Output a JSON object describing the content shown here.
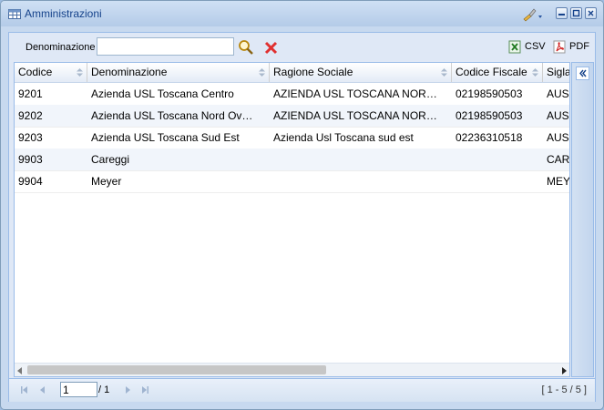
{
  "window": {
    "title": "Amministrazioni"
  },
  "toolbar": {
    "filter_label": "Denominazione",
    "filter_value": "",
    "csv_label": "CSV",
    "pdf_label": "PDF"
  },
  "grid": {
    "columns": [
      "Codice",
      "Denominazione",
      "Ragione Sociale",
      "Codice Fiscale",
      "Sigla"
    ],
    "rows": [
      [
        "9201",
        "Azienda USL Toscana Centro",
        "AZIENDA USL TOSCANA NOR…",
        "02198590503",
        "AUSL"
      ],
      [
        "9202",
        "Azienda USL Toscana Nord Ov…",
        "AZIENDA USL TOSCANA NOR…",
        "02198590503",
        "AUSL"
      ],
      [
        "9203",
        "Azienda USL Toscana Sud Est",
        "Azienda Usl Toscana sud est",
        "02236310518",
        "AUSL"
      ],
      [
        "9903",
        "Careggi",
        "",
        "",
        "CAR"
      ],
      [
        "9904",
        "Meyer",
        "",
        "",
        "MEY"
      ]
    ]
  },
  "pager": {
    "current_page": "1",
    "total_pages": "/ 1",
    "info": "[ 1 - 5 / 5 ]"
  },
  "colors": {
    "title": "#15428b",
    "border": "#99bbe8",
    "panel": "#dfe8f6"
  }
}
